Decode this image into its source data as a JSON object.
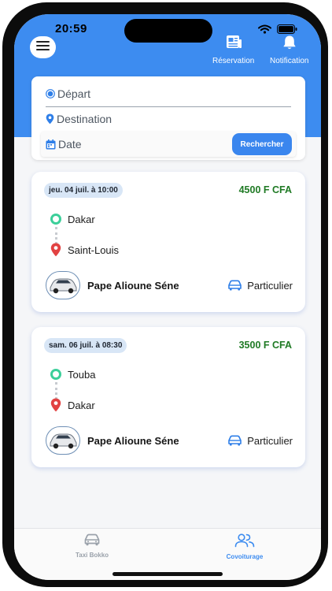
{
  "status_bar": {
    "time": "20:59"
  },
  "header": {
    "actions": [
      {
        "label": "Réservation",
        "icon": "newspaper-icon"
      },
      {
        "label": "Notification",
        "icon": "bell-icon"
      }
    ]
  },
  "search": {
    "departure_placeholder": "Départ",
    "destination_placeholder": "Destination",
    "date_placeholder": "Date",
    "button_label": "Rechercher"
  },
  "rides": [
    {
      "date": "jeu. 04 juil. à 10:00",
      "price": "4500 F CFA",
      "from": "Dakar",
      "to": "Saint-Louis",
      "driver": "Pape Alioune Séne",
      "driver_type": "Particulier"
    },
    {
      "date": "sam. 06 juil. à 08:30",
      "price": "3500 F CFA",
      "from": "Touba",
      "to": "Dakar",
      "driver": "Pape Alioune Séne",
      "driver_type": "Particulier"
    }
  ],
  "tabs": [
    {
      "label": "Taxi Bokko",
      "icon": "car-icon",
      "active": false
    },
    {
      "label": "Covoiturage",
      "icon": "users-icon",
      "active": true
    }
  ],
  "colors": {
    "primary": "#3d8cf0",
    "price": "#1f7a24",
    "origin": "#3ccf9a",
    "destination": "#e24242",
    "inactive": "#9aa1aa"
  }
}
